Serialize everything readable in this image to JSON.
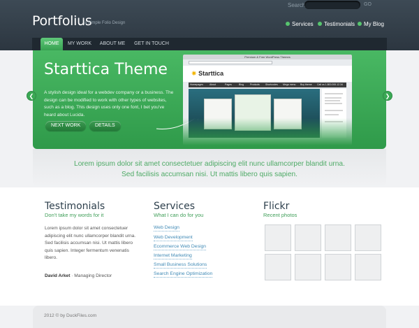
{
  "header": {
    "search_label": "Search",
    "search_button": "GO",
    "logo": "Portfolius",
    "tagline": "a Simple Folio Design",
    "links": [
      {
        "label": "Services"
      },
      {
        "label": "Testimonials"
      },
      {
        "label": "My Blog"
      }
    ]
  },
  "nav": {
    "items": [
      {
        "label": "HOME",
        "active": true
      },
      {
        "label": "MY WORK",
        "active": false
      },
      {
        "label": "ABOUT ME",
        "active": false
      },
      {
        "label": "GET IN TOUCH",
        "active": false
      }
    ]
  },
  "banner": {
    "title": "Starttica Theme",
    "text": "A stylish design ideal for a webdev company or a business. The design can be modified to work with other types of websites, such as a blog. This design uses only one font, I bet you've heard about Lucida.",
    "next_button": "NEXT WORK",
    "details_button": "DETAILS",
    "prev_icon": "left-arrow-icon",
    "next_icon": "right-arrow-icon",
    "preview": {
      "window_title": "Premium & Free WordPress Themes",
      "logo": "Starttica",
      "nav": [
        "Homepages",
        "About",
        "Pages",
        "Blog",
        "Products",
        "Shortcodes",
        "Mega menu",
        "Buy theme",
        "Call us 1.800.000.12.34"
      ]
    }
  },
  "tagline": {
    "line1": "Lorem ipsum dolor sit amet consectetuer adipiscing elit nunc ullamcorper blandit urna.",
    "line2": "Sed facilisis accumsan nisi. Ut mattis libero quis sapien."
  },
  "testimonials": {
    "title": "Testimonials",
    "subtitle": "Don't take my words for it",
    "body": "Lorem ipsum dolor sit amet consectetuer adipiscing elit nunc ullamcorper blandit urna. Sed facilisis accumsan nisi. Ut mattis libero quis sapien. Integer fermentum venenatis libero.",
    "author": "David Arket",
    "role": "Managing Director"
  },
  "services": {
    "title": "Services",
    "subtitle": "What I can do for you",
    "items": [
      "Web Design",
      "Web Development",
      "Ecommerce Web Design",
      "Internet Marketing",
      "Small Business Solutions",
      "Search Engine Optimization"
    ]
  },
  "flickr": {
    "title": "Flickr",
    "subtitle": "Recent photos",
    "photo_count": 8
  },
  "footer": {
    "text": "2012 © by DuckFiles.com"
  },
  "colors": {
    "header_dark": "#2c3640",
    "accent_green": "#3f9e58",
    "link_blue": "#3f89b5"
  }
}
